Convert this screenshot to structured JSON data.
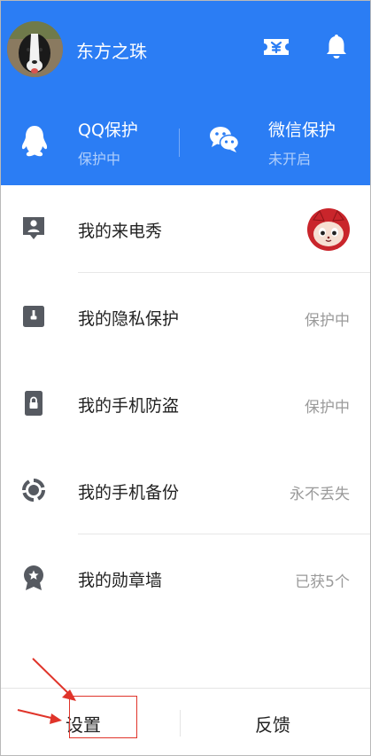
{
  "profile": {
    "username": "东方之珠",
    "avatar_icon": "dog-photo-avatar"
  },
  "header_icons": {
    "ticket": "ticket-icon",
    "bell": "bell-icon"
  },
  "protections": [
    {
      "title": "QQ保护",
      "status": "保护中",
      "icon": "qq-penguin-icon"
    },
    {
      "title": "微信保护",
      "status": "未开启",
      "icon": "wechat-icon"
    }
  ],
  "menu": [
    {
      "label": "我的来电秀",
      "value": "",
      "icon": "contact-card-icon"
    },
    {
      "label": "我的隐私保护",
      "value": "保护中",
      "icon": "privacy-lock-icon"
    },
    {
      "label": "我的手机防盗",
      "value": "保护中",
      "icon": "phone-lock-icon"
    },
    {
      "label": "我的手机备份",
      "value": "永不丢失",
      "icon": "backup-sync-icon"
    },
    {
      "label": "我的勋章墙",
      "value": "已获5个",
      "icon": "medal-icon"
    }
  ],
  "bottom": {
    "settings_label": "设置",
    "feedback_label": "反馈"
  },
  "colors": {
    "header_blue": "#2b7df4",
    "annotation_red": "#e0342a",
    "icon_gray": "#565a61"
  }
}
